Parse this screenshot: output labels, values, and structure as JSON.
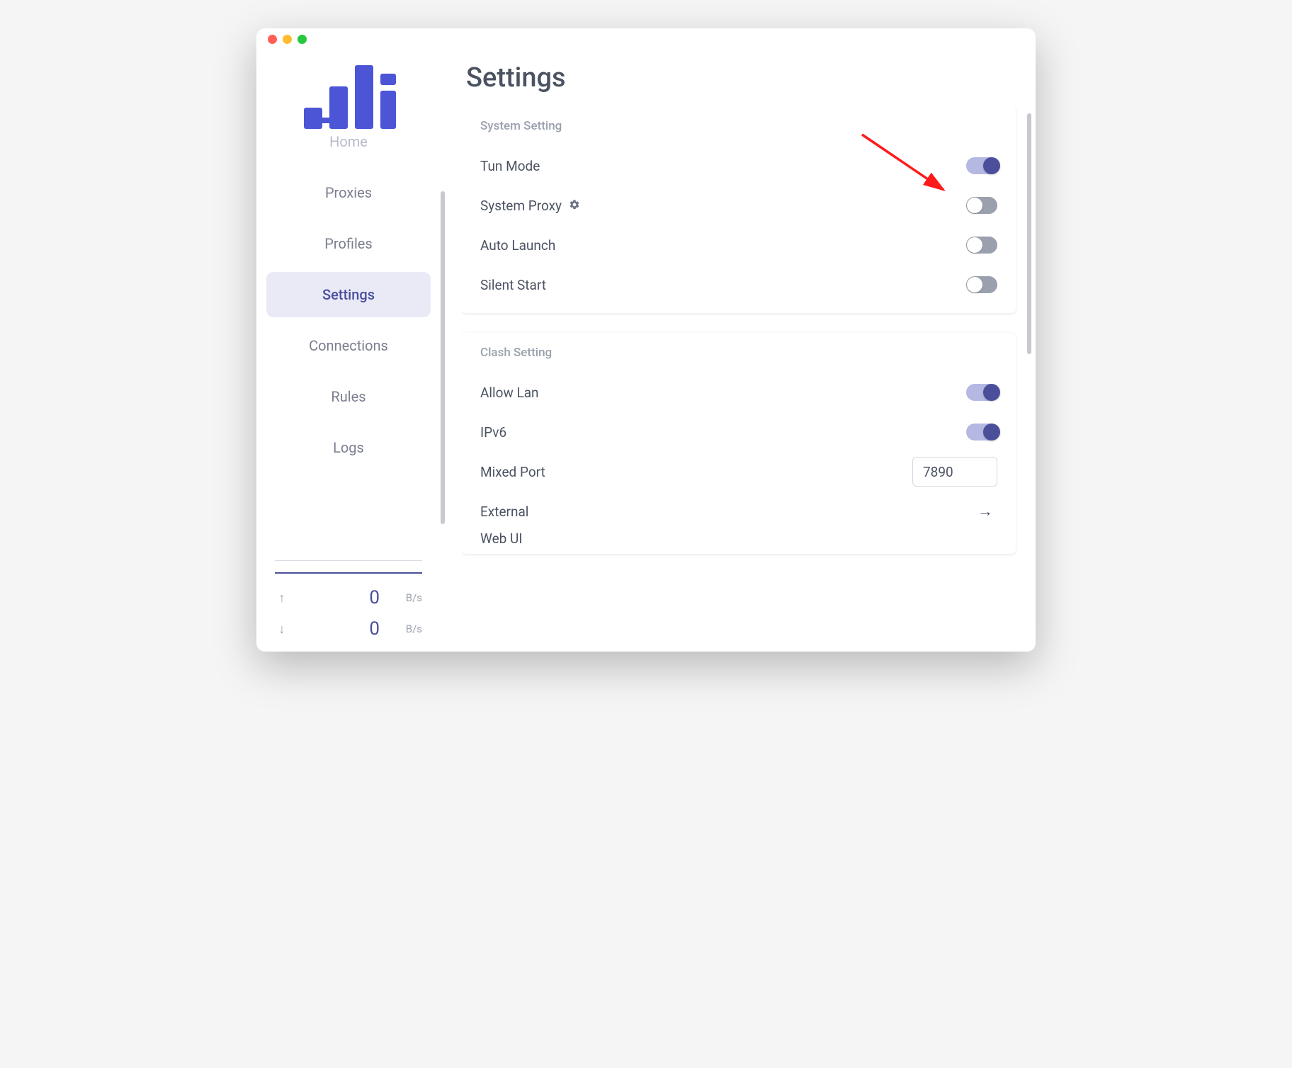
{
  "page": {
    "title": "Settings"
  },
  "sidebar": {
    "items": [
      {
        "label": "Home"
      },
      {
        "label": "Proxies"
      },
      {
        "label": "Profiles"
      },
      {
        "label": "Settings"
      },
      {
        "label": "Connections"
      },
      {
        "label": "Rules"
      },
      {
        "label": "Logs"
      }
    ],
    "stats": {
      "up": {
        "value": "0",
        "unit": "B/s"
      },
      "down": {
        "value": "0",
        "unit": "B/s"
      }
    }
  },
  "system_setting": {
    "title": "System Setting",
    "tun_mode": {
      "label": "Tun Mode",
      "on": true
    },
    "system_proxy": {
      "label": "System Proxy",
      "on": false
    },
    "auto_launch": {
      "label": "Auto Launch",
      "on": false
    },
    "silent_start": {
      "label": "Silent Start",
      "on": false
    }
  },
  "clash_setting": {
    "title": "Clash Setting",
    "allow_lan": {
      "label": "Allow Lan",
      "on": true
    },
    "ipv6": {
      "label": "IPv6",
      "on": true
    },
    "mixed_port": {
      "label": "Mixed Port",
      "value": "7890"
    },
    "external": {
      "label": "External"
    },
    "web_ui": {
      "label": "Web UI"
    }
  },
  "colors": {
    "accent": "#4b4f9b",
    "accent_light": "#b4b8e2",
    "text": "#4b5261",
    "muted": "#9aa0ad"
  }
}
